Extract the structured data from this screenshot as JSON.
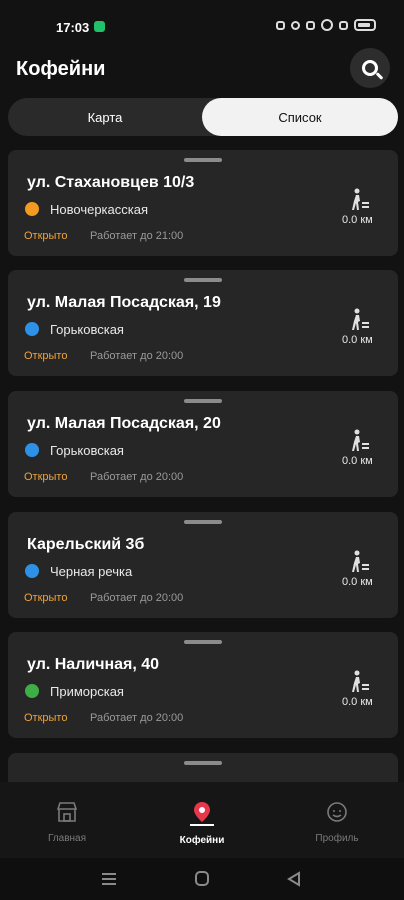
{
  "status_bar": {
    "time": "17:03",
    "battery": "79"
  },
  "header": {
    "title": "Кофейни",
    "search_icon": "search-icon"
  },
  "view_toggle": {
    "map_label": "Карта",
    "list_label": "Список",
    "selected": "Список"
  },
  "colors": {
    "open": "#f0a33a",
    "metro_orange": "#f29a21",
    "metro_blue": "#2e91e8",
    "metro_green": "#3fae47"
  },
  "cafes": [
    {
      "address": "ул. Стахановцев 10/3",
      "metro": "Новочеркасская",
      "metro_color": "#f29a21",
      "status": "Открыто",
      "hours": "Работает до 21:00",
      "distance": "0.0 км"
    },
    {
      "address": "ул. Малая Посадская, 19",
      "metro": "Горьковская",
      "metro_color": "#2e91e8",
      "status": "Открыто",
      "hours": "Работает до 20:00",
      "distance": "0.0 км"
    },
    {
      "address": "ул. Малая Посадская, 20",
      "metro": "Горьковская",
      "metro_color": "#2e91e8",
      "status": "Открыто",
      "hours": "Работает до 20:00",
      "distance": "0.0 км"
    },
    {
      "address": "Карельский 3б",
      "metro": "Черная речка",
      "metro_color": "#2e91e8",
      "status": "Открыто",
      "hours": "Работает до 20:00",
      "distance": "0.0 км"
    },
    {
      "address": "ул. Наличная, 40",
      "metro": "Приморская",
      "metro_color": "#3fae47",
      "status": "Открыто",
      "hours": "Работает до 20:00",
      "distance": "0.0 км"
    }
  ],
  "bottom_nav": {
    "items": [
      {
        "label": "Главная",
        "icon": "store-icon",
        "active": false
      },
      {
        "label": "Кофейни",
        "icon": "location-pin-icon",
        "active": true
      },
      {
        "label": "Профиль",
        "icon": "profile-icon",
        "active": false
      }
    ]
  }
}
